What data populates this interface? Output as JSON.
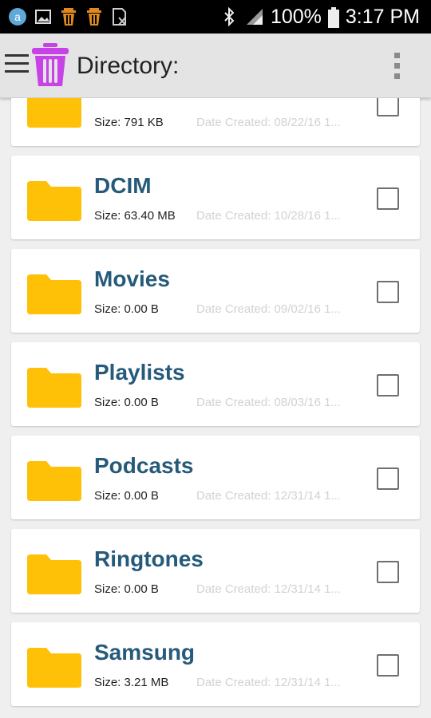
{
  "status_bar": {
    "notification_icons": [
      "amazon-icon",
      "image-icon",
      "trash-notification-icon",
      "trash-notification-icon",
      "document-x-icon"
    ],
    "battery_percent": "100%",
    "time": "3:17 PM"
  },
  "toolbar": {
    "title": "Directory:"
  },
  "folders": [
    {
      "name": "",
      "size": "Size: 791 KB",
      "date": "Date Created: 08/22/16 1..."
    },
    {
      "name": "DCIM",
      "size": "Size: 63.40 MB",
      "date": "Date Created: 10/28/16 1..."
    },
    {
      "name": "Movies",
      "size": "Size: 0.00 B",
      "date": "Date Created: 09/02/16 1..."
    },
    {
      "name": "Playlists",
      "size": "Size: 0.00 B",
      "date": "Date Created: 08/03/16 1..."
    },
    {
      "name": "Podcasts",
      "size": "Size: 0.00 B",
      "date": "Date Created: 12/31/14 1..."
    },
    {
      "name": "Ringtones",
      "size": "Size: 0.00 B",
      "date": "Date Created: 12/31/14 1..."
    },
    {
      "name": "Samsung",
      "size": "Size: 3.21 MB",
      "date": "Date Created: 12/31/14 1..."
    }
  ],
  "colors": {
    "folder": "#ffc107",
    "folder_name": "#265a7a",
    "app_logo": "#c743e8"
  }
}
